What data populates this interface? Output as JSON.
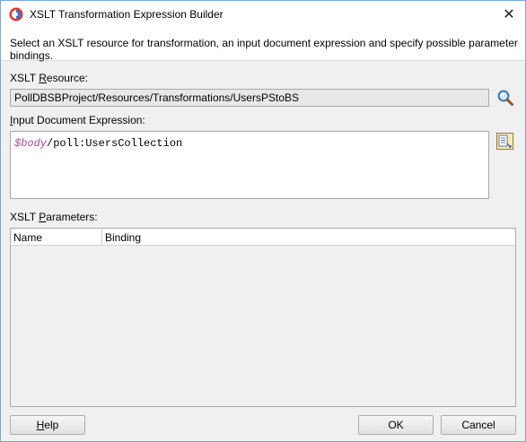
{
  "window": {
    "title": "XSLT Transformation Expression Builder",
    "close_glyph": "✕",
    "icon": "oracle-jdev-icon"
  },
  "header": {
    "description": "Select an XSLT resource for transformation, an input document expression and specify possible parameter bindings."
  },
  "xslt_resource": {
    "label_pre": "XSLT ",
    "label_mnemonic": "R",
    "label_post": "esource:",
    "value": "PollDBSBProject/Resources/Transformations/UsersPStoBS",
    "browse_icon": "search-icon"
  },
  "input_expression": {
    "label_mnemonic": "I",
    "label_post": "nput Document Expression:",
    "variable": "$body",
    "path": "/poll:UsersCollection",
    "editor_icon": "expression-editor-icon"
  },
  "parameters": {
    "label_pre": "XSLT ",
    "label_mnemonic": "P",
    "label_post": "arameters:",
    "columns": [
      "Name",
      "Binding"
    ],
    "rows": []
  },
  "buttons": {
    "help_mnemonic": "H",
    "help_rest": "elp",
    "ok": "OK",
    "cancel": "Cancel"
  },
  "colors": {
    "variable_text": "#b0459f",
    "window_border": "#7aa7d6",
    "dialog_bg": "#f0f0f0"
  }
}
